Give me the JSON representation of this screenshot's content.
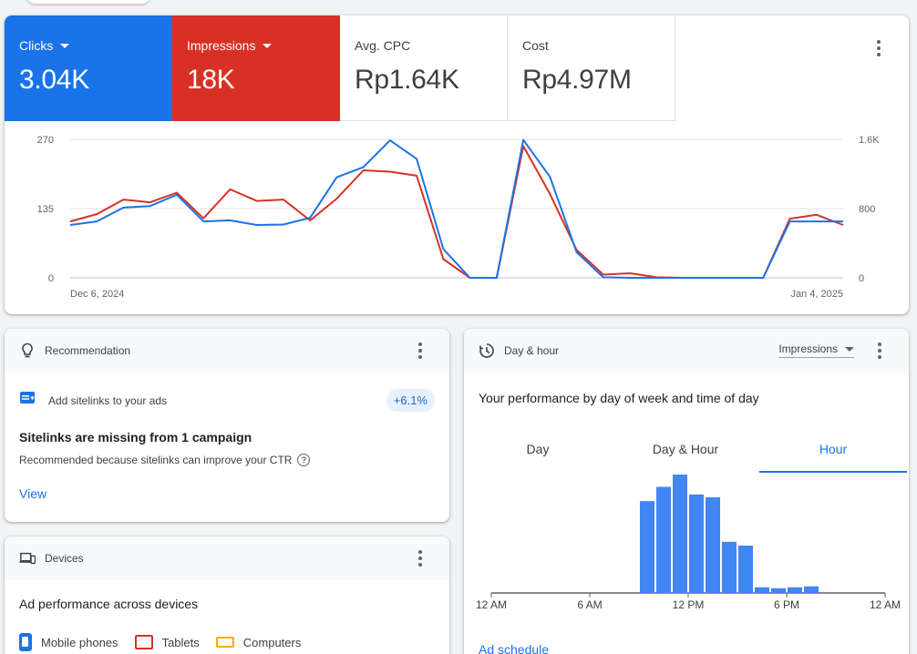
{
  "metrics": [
    {
      "label": "Clicks",
      "value": "3.04K",
      "dropdown": true,
      "color": "#1a73e8"
    },
    {
      "label": "Impressions",
      "value": "18K",
      "dropdown": true,
      "color": "#d93025"
    },
    {
      "label": "Avg. CPC",
      "value": "Rp1.64K",
      "dropdown": false
    },
    {
      "label": "Cost",
      "value": "Rp4.97M",
      "dropdown": false
    }
  ],
  "chart_data": [
    {
      "type": "line",
      "x_start_label": "Dec 6, 2024",
      "x_end_label": "Jan 4, 2025",
      "left_axis": {
        "ticks": [
          "0",
          "135",
          "270"
        ],
        "range": [
          0,
          270
        ]
      },
      "right_axis": {
        "ticks": [
          "0",
          "800",
          "1.6K"
        ],
        "range": [
          0,
          1600
        ]
      },
      "series": [
        {
          "name": "Clicks",
          "axis": "left",
          "color": "#1a73e8",
          "values": [
            103,
            110,
            137,
            140,
            162,
            110,
            112,
            103,
            104,
            117,
            196,
            216,
            268,
            232,
            56,
            0,
            0,
            269,
            197,
            50,
            1,
            0,
            0,
            0,
            0,
            0,
            0,
            110,
            110,
            110
          ]
        },
        {
          "name": "Impressions",
          "axis": "right",
          "color": "#d93025",
          "values": [
            652,
            736,
            904,
            873,
            983,
            687,
            1022,
            888,
            904,
            663,
            915,
            1242,
            1226,
            1180,
            216,
            0,
            0,
            1522,
            969,
            322,
            37,
            53,
            6,
            0,
            0,
            0,
            0,
            683,
            728,
            611
          ]
        }
      ],
      "grid": true
    },
    {
      "type": "bar",
      "metric": "Impressions",
      "categories": [
        "12 AM",
        "1 AM",
        "2 AM",
        "3 AM",
        "4 AM",
        "5 AM",
        "6 AM",
        "7 AM",
        "8 AM",
        "9 AM",
        "10 AM",
        "11 AM",
        "12 PM",
        "1 PM",
        "2 PM",
        "3 PM",
        "4 PM",
        "5 PM",
        "6 PM",
        "7 PM",
        "8 PM",
        "9 PM",
        "10 PM",
        "11 PM"
      ],
      "x_tick_labels": [
        "12 AM",
        "6 AM",
        "12 PM",
        "6 PM",
        "12 AM"
      ],
      "values": [
        0,
        0,
        0,
        0,
        0,
        0,
        0,
        0,
        0,
        97,
        112,
        125,
        104,
        101,
        54,
        50,
        6,
        5,
        6,
        7,
        0,
        0,
        0,
        0
      ],
      "color": "#4285f4"
    }
  ],
  "recommendation": {
    "header": "Recommendation",
    "item_text": "Add sitelinks to your ads",
    "uplift": "+6.1%",
    "title": "Sitelinks are missing from 1 campaign",
    "subtitle": "Recommended because sitelinks can improve your CTR",
    "action": "View"
  },
  "devices": {
    "header": "Devices",
    "title": "Ad performance across devices",
    "legend": [
      {
        "label": "Mobile phones",
        "color": "#1a73e8"
      },
      {
        "label": "Tablets",
        "color": "#d93025"
      },
      {
        "label": "Computers",
        "color": "#f9ab00"
      }
    ]
  },
  "dayhour": {
    "header": "Day & hour",
    "metric_select": "Impressions",
    "title": "Your performance by day of week and time of day",
    "tabs": [
      "Day",
      "Day & Hour",
      "Hour"
    ],
    "active_tab": "Hour",
    "link": "Ad schedule"
  },
  "icons": {
    "recommendation": "lightbulb-icon",
    "sitelink": "sitelink-icon",
    "devices": "devices-icon",
    "dayhour": "clock-history-icon",
    "more": "more-vert-icon",
    "help": "help-icon"
  }
}
